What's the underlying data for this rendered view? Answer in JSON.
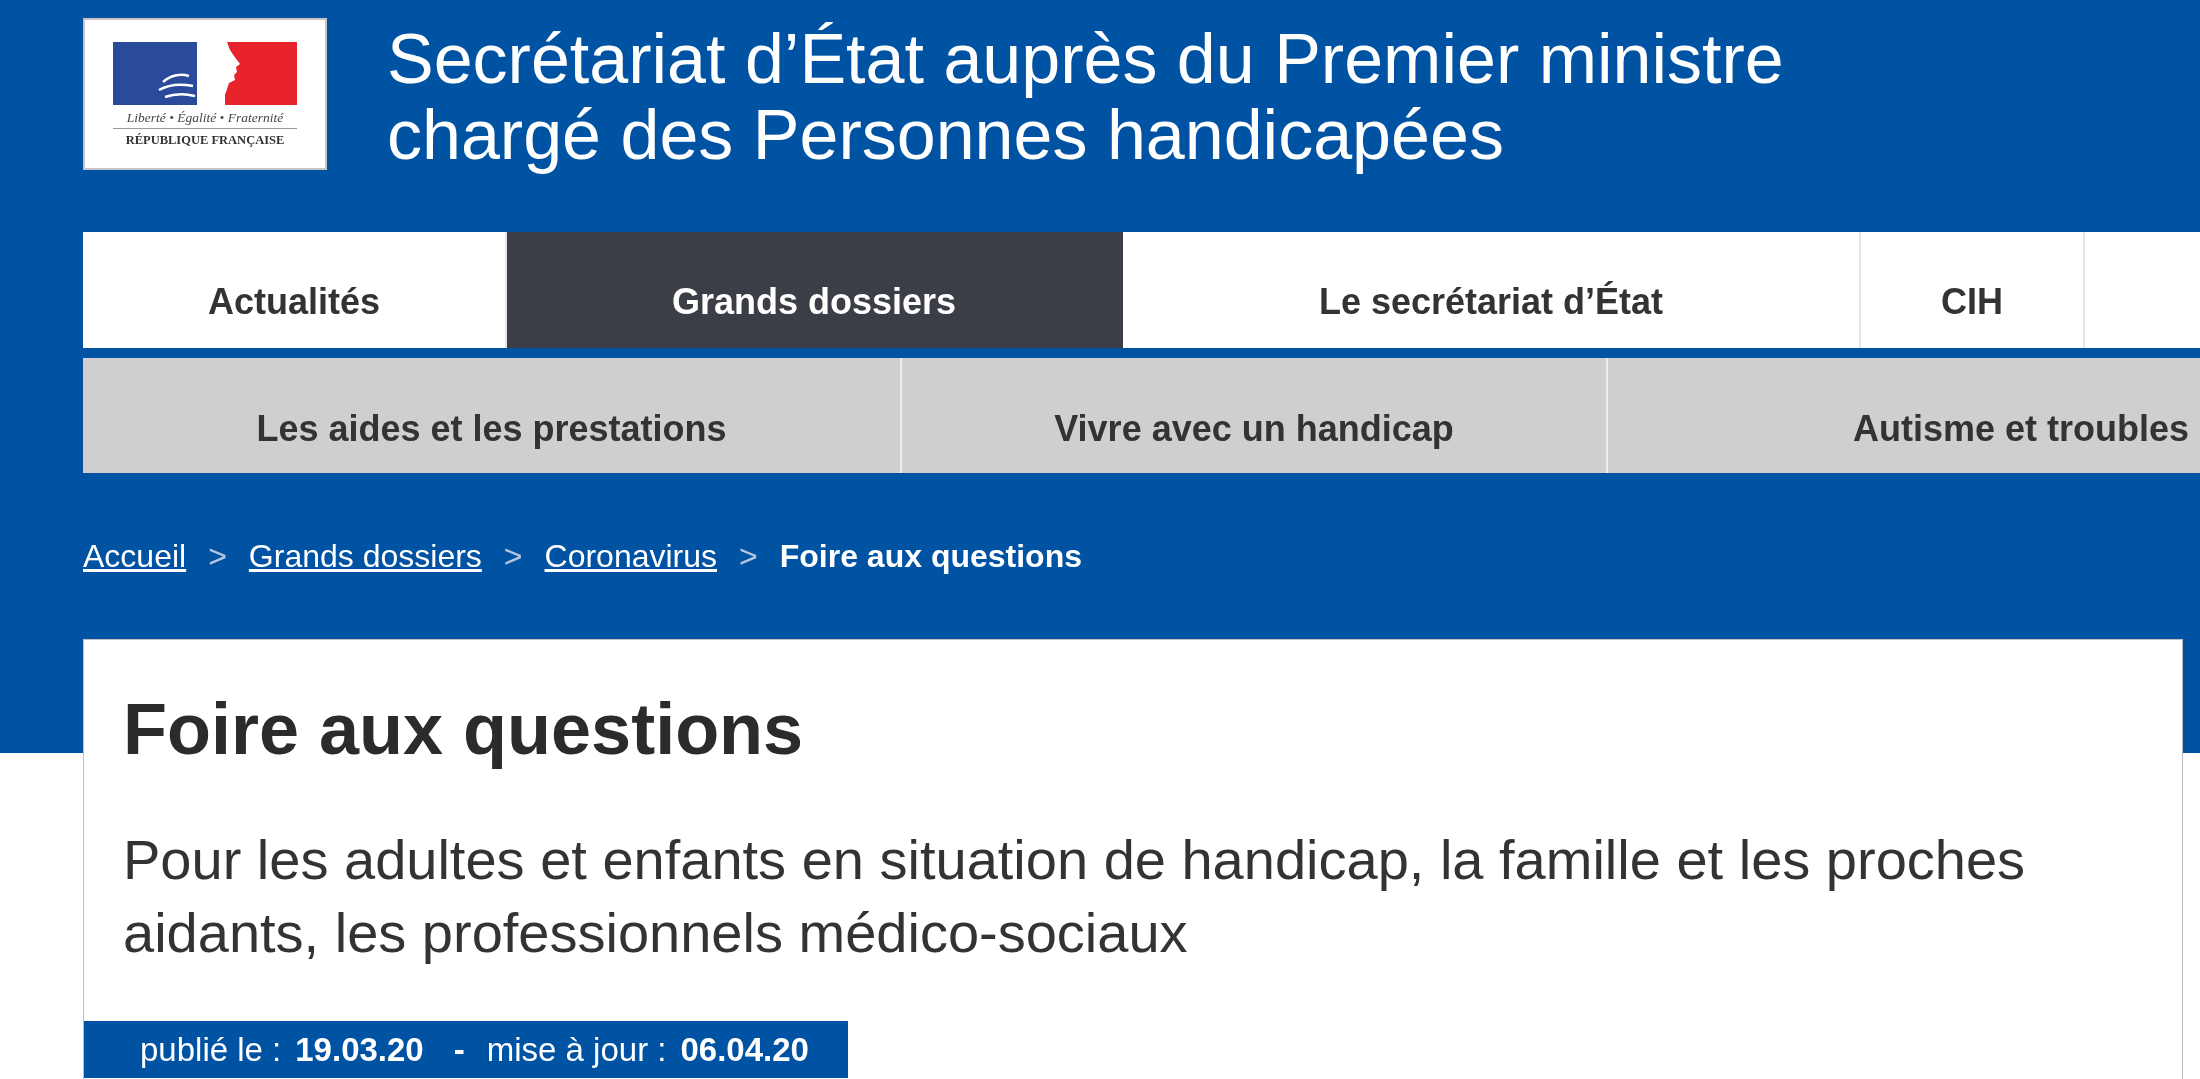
{
  "header": {
    "logo": {
      "motto": "Liberté • Égalité • Fraternité",
      "name": "RÉPUBLIQUE FRANÇAISE"
    },
    "title": "Secrétariat d’État auprès du Premier ministre chargé des Personnes handicapées"
  },
  "main_nav": [
    {
      "label": "Actualités",
      "selected": false
    },
    {
      "label": "Grands dossiers",
      "selected": true
    },
    {
      "label": "Le secrétariat d’État",
      "selected": false
    },
    {
      "label": "CIH",
      "selected": false
    }
  ],
  "sub_nav": [
    {
      "label": "Les aides et les prestations",
      "selected": false
    },
    {
      "label": "Vivre avec un handicap",
      "selected": false
    },
    {
      "label": "Autisme et troubles",
      "selected": false
    }
  ],
  "breadcrumb": [
    {
      "kind": "link",
      "text": "Accueil"
    },
    {
      "kind": "separator",
      "text": ">"
    },
    {
      "kind": "link",
      "text": "Grands dossiers"
    },
    {
      "kind": "separator",
      "text": ">"
    },
    {
      "kind": "link",
      "text": "Coronavirus"
    },
    {
      "kind": "separator",
      "text": ">"
    },
    {
      "kind": "current",
      "text": "Foire aux questions"
    }
  ],
  "article": {
    "title": "Foire aux questions",
    "subtitle": "Pour les adultes et enfants en situation de handicap, la famille et les proches aidants, les professionnels médico-sociaux",
    "dates": {
      "published_label": "publié le :",
      "published": "19.03.20",
      "separator": "-",
      "updated_label": "mise à jour :",
      "updated": "06.04.20"
    }
  }
}
